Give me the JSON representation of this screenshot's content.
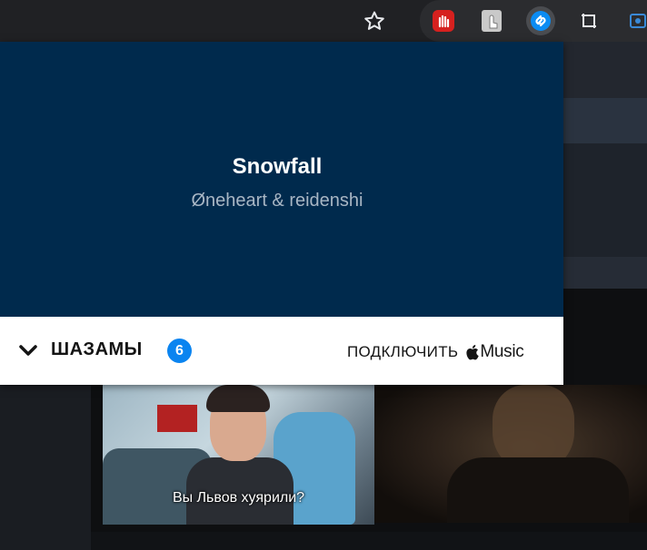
{
  "toolbar": {
    "bookmark_icon": "star-icon",
    "extensions": [
      "hand-stop-icon",
      "touch-icon",
      "shazam-icon",
      "crop-icon",
      "record-icon"
    ]
  },
  "popup": {
    "song_title": "Snowfall",
    "song_artist": "Øneheart & reidenshi",
    "hero_color": "#002a4d",
    "shazams_label": "ШАЗАМЫ",
    "shazams_count": "6",
    "badge_color": "#0a84f0",
    "connect_label": "ПОДКЛЮЧИТЬ",
    "music_label": "Music"
  },
  "video": {
    "subtitle": "Вы Львов хуярили?"
  }
}
